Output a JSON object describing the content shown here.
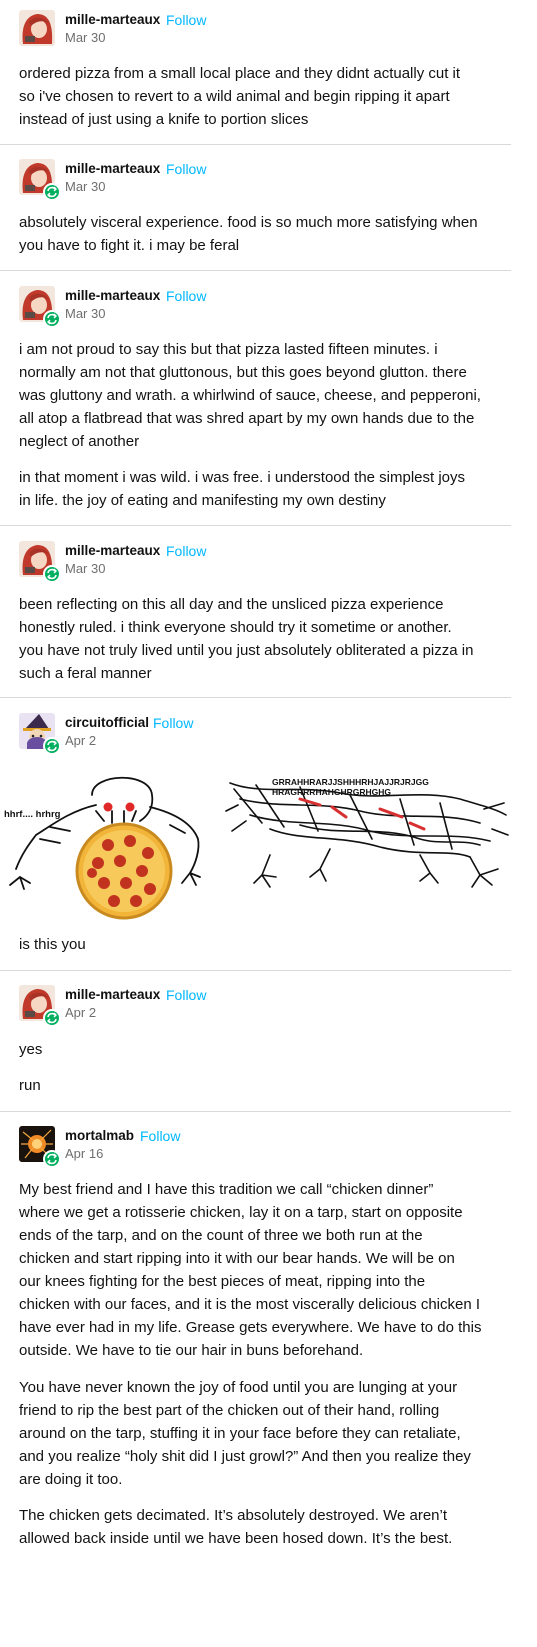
{
  "colors": {
    "follow": "#00b8ff",
    "reblog_badge": "#00b060",
    "divider": "#d9d9d9",
    "date": "#6e6e6e"
  },
  "posts": [
    {
      "username": "mille-marteaux",
      "follow": "Follow",
      "date": "Mar 30",
      "avatar": "red-haired-character-avatar",
      "reblog_icon": false,
      "paragraphs": [
        [
          "ordered pizza from a small local place and they didnt actually cut it",
          "so i've chosen to revert to a wild animal and begin ripping it apart",
          "instead of just using a knife to portion slices"
        ]
      ]
    },
    {
      "username": "mille-marteaux",
      "follow": "Follow",
      "date": "Mar 30",
      "avatar": "red-haired-character-avatar",
      "reblog_icon": true,
      "paragraphs": [
        [
          "absolutely visceral experience. food is so much more satisfying when",
          "you have to fight it. i may be feral"
        ]
      ]
    },
    {
      "username": "mille-marteaux",
      "follow": "Follow",
      "date": "Mar 30",
      "avatar": "red-haired-character-avatar",
      "reblog_icon": true,
      "paragraphs": [
        [
          "i am not proud to say this but that pizza lasted fifteen minutes. i",
          "normally am not that gluttonous, but this goes beyond glutton. there",
          "was gluttony and wrath. a whirlwind of sauce, cheese, and pepperoni,",
          "all atop a flatbread that was shred apart by my own hands due to the",
          "neglect of another"
        ],
        [
          "in that moment i was wild. i was free. i understood the simplest joys",
          "in life. the joy of eating and manifesting my own destiny"
        ]
      ]
    },
    {
      "username": "mille-marteaux",
      "follow": "Follow",
      "date": "Mar 30",
      "avatar": "red-haired-character-avatar",
      "reblog_icon": true,
      "paragraphs": [
        [
          "been reflecting on this all day and the unsliced pizza experience",
          "honestly ruled. i think everyone should try it sometime or another.",
          "you have not truly lived until you just absolutely obliterated a pizza in",
          "such a feral manner"
        ]
      ]
    },
    {
      "username": "circuitofficial",
      "follow": "Follow",
      "date": "Apr 2",
      "avatar": "witch-hat-character-avatar",
      "reblog_icon": true,
      "image": {
        "left_caption": "hhrf.... hrhrg",
        "right_caption_line1": "GRRAHHRARJJSHHHRHJAJJRJRJGG",
        "right_caption_line2": "HRAGRRRHAHGHRGRHGHG"
      },
      "paragraphs": [
        [
          "is this you"
        ]
      ]
    },
    {
      "username": "mille-marteaux",
      "follow": "Follow",
      "date": "Apr 2",
      "avatar": "red-haired-character-avatar",
      "reblog_icon": true,
      "paragraphs": [
        [
          "yes"
        ],
        [
          "run"
        ]
      ]
    },
    {
      "username": "mortalmab",
      "follow": "Follow",
      "date": "Apr 16",
      "avatar": "fire-sparks-avatar",
      "reblog_icon": true,
      "paragraphs": [
        [
          "My best friend and I have this tradition we call “chicken dinner”",
          "where we get a rotisserie chicken, lay it on a tarp, start on opposite",
          "ends of the tarp, and on the count of three we both run at the",
          "chicken and start ripping into it with our bear hands. We will be on",
          "our knees fighting for the best pieces of meat, ripping into the",
          "chicken with our faces, and it is the most viscerally delicious chicken I",
          "have ever had in my life. Grease gets everywhere. We have to do this",
          "outside. We have to tie our hair in buns beforehand."
        ],
        [
          "You have never known the joy of food until you are lunging at your",
          "friend to rip the best part of the chicken out of their hand, rolling",
          "around on the tarp, stuffing it in your face before they can retaliate,",
          "and  you realize “holy shit did I just growl?” And then you realize they",
          "are doing it too."
        ],
        [
          "The chicken gets decimated. It’s absolutely destroyed. We aren’t",
          "allowed back inside until we have been hosed down. It’s the best."
        ]
      ]
    }
  ]
}
